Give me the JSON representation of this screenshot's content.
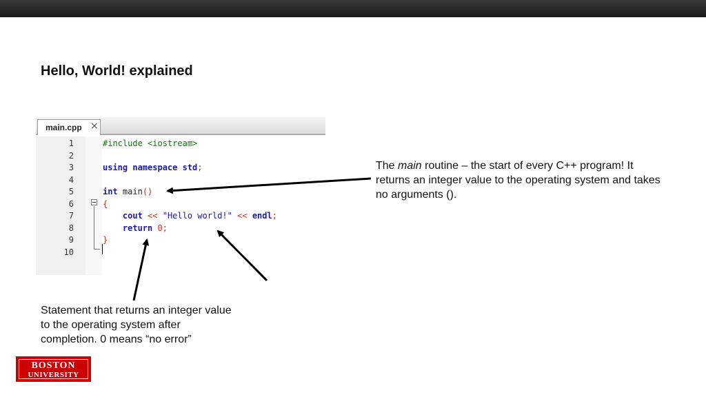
{
  "slide": {
    "title": "Hello, World! explained"
  },
  "editor": {
    "tab_label": "main.cpp",
    "tab_close": "×",
    "lines": [
      {
        "num": "1",
        "parts": [
          {
            "c": "pp",
            "t": "#include <iostream>"
          }
        ]
      },
      {
        "num": "2",
        "parts": []
      },
      {
        "num": "3",
        "parts": [
          {
            "c": "kw",
            "t": "using namespace"
          },
          {
            "c": "tx",
            "t": " "
          },
          {
            "c": "kw",
            "t": "std"
          },
          {
            "c": "pn",
            "t": ";"
          }
        ]
      },
      {
        "num": "4",
        "parts": []
      },
      {
        "num": "5",
        "parts": [
          {
            "c": "kw",
            "t": "int"
          },
          {
            "c": "tx",
            "t": " main"
          },
          {
            "c": "pn",
            "t": "()"
          }
        ]
      },
      {
        "num": "6",
        "parts": [
          {
            "c": "pn",
            "t": "{"
          }
        ]
      },
      {
        "num": "7",
        "parts": [
          {
            "c": "tx",
            "t": "    "
          },
          {
            "c": "kw",
            "t": "cout"
          },
          {
            "c": "tx",
            "t": " "
          },
          {
            "c": "pn",
            "t": "<<"
          },
          {
            "c": "tx",
            "t": " "
          },
          {
            "c": "st",
            "t": "\"Hello world!\""
          },
          {
            "c": "tx",
            "t": " "
          },
          {
            "c": "pn",
            "t": "<<"
          },
          {
            "c": "tx",
            "t": " "
          },
          {
            "c": "kw",
            "t": "endl"
          },
          {
            "c": "pn",
            "t": ";"
          }
        ]
      },
      {
        "num": "8",
        "parts": [
          {
            "c": "tx",
            "t": "    "
          },
          {
            "c": "kw",
            "t": "return"
          },
          {
            "c": "tx",
            "t": " "
          },
          {
            "c": "nm",
            "t": "0"
          },
          {
            "c": "pn",
            "t": ";"
          }
        ]
      },
      {
        "num": "9",
        "parts": [
          {
            "c": "pn",
            "t": "}"
          }
        ]
      },
      {
        "num": "10",
        "parts": []
      }
    ]
  },
  "annotations": {
    "main_prefix": "The ",
    "main_italic": "main",
    "main_rest": " routine – the start of every C++ program!  It returns an integer value to the operating system and takes no arguments ().",
    "return_text": "Statement that returns an integer value to the operating system after completion. 0 means “no error”"
  },
  "logo": {
    "line1": "BOSTON",
    "line2": "UNIVERSITY",
    "color": "#cc0000"
  }
}
